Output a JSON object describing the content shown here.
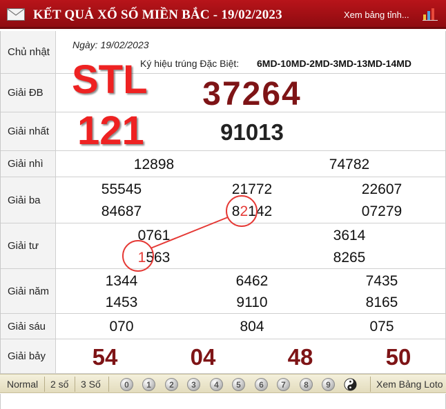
{
  "header": {
    "title": "KẾT QUẢ XỔ SỐ MIỀN BẮC - 19/02/2023",
    "view_table": "Xem bảng tỉnh...",
    "mail_icon": "mail-icon",
    "chart_icon": "bar-chart-icon"
  },
  "info": {
    "day_label": "Chủ nhật",
    "date": "Ngày: 19/02/2023",
    "symbol_label": "Ký hiệu trúng Đặc Biệt:",
    "symbol_value": "6MD-10MD-2MD-3MD-13MD-14MD"
  },
  "overlay_text": {
    "stl": "STL",
    "number": "121"
  },
  "prizes": {
    "db": {
      "label": "Giải ĐB",
      "numbers": [
        "37264"
      ]
    },
    "nhat": {
      "label": "Giải nhất",
      "numbers": [
        "91013"
      ]
    },
    "nhi": {
      "label": "Giải nhì",
      "numbers": [
        "12898",
        "74782"
      ]
    },
    "ba": {
      "label": "Giải ba",
      "numbers": [
        "55545",
        "21772",
        "22607",
        "84687",
        "82142",
        "07279"
      ]
    },
    "tu": {
      "label": "Giải tư",
      "numbers": [
        "0761",
        "3614",
        "1563",
        "8265"
      ]
    },
    "nam": {
      "label": "Giải năm",
      "numbers": [
        "1344",
        "6462",
        "7435",
        "1453",
        "9110",
        "8165"
      ]
    },
    "sau": {
      "label": "Giải sáu",
      "numbers": [
        "070",
        "804",
        "075"
      ]
    },
    "bay": {
      "label": "Giải bảy",
      "numbers": [
        "54",
        "04",
        "48",
        "50"
      ]
    }
  },
  "highlights": {
    "ba_prefix": "8",
    "ba_digit": "2",
    "ba_suffix": "142",
    "tu_digit": "1",
    "tu_suffix": "563",
    "color": "#e53935"
  },
  "footer": {
    "normal": "Normal",
    "two_digits": "2 số",
    "three_digits": "3 Số",
    "balls": [
      "0",
      "1",
      "2",
      "3",
      "4",
      "5",
      "6",
      "7",
      "8",
      "9"
    ],
    "yin_yang_icon": "yin-yang-icon",
    "loto": "Xem Bảng Loto"
  }
}
